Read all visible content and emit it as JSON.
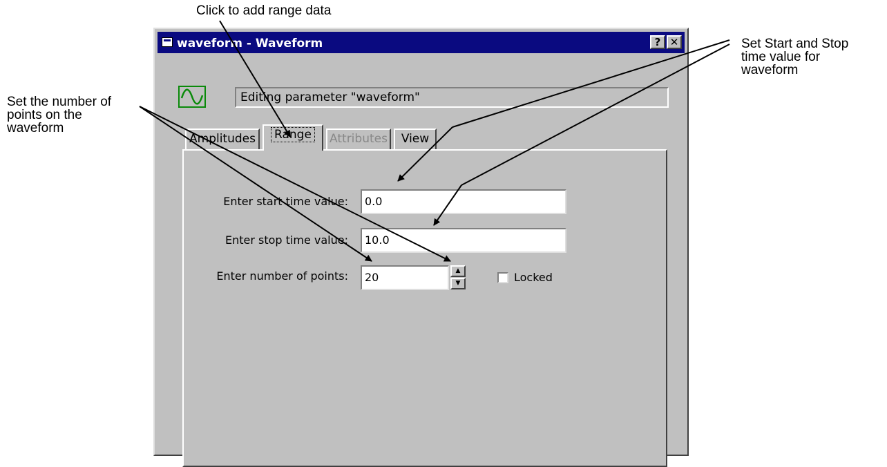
{
  "callouts": {
    "range": "Click to add range data",
    "start_stop": [
      "Set Start and Stop",
      "time value for",
      "waveform"
    ],
    "points": [
      "Set the number of",
      "points on the",
      "waveform"
    ]
  },
  "window": {
    "title": "waveform - Waveform",
    "help_label": "?",
    "close_label": "✕"
  },
  "editing_label": "Editing parameter \"waveform\"",
  "tabs": [
    {
      "label": "Amplitudes",
      "state": "normal"
    },
    {
      "label": "Range",
      "state": "active"
    },
    {
      "label": "Attributes",
      "state": "disabled"
    },
    {
      "label": "View",
      "state": "normal"
    }
  ],
  "form": {
    "start_label": "Enter start time value:",
    "start_value": "0.0",
    "stop_label": "Enter stop time value:",
    "stop_value": "10.0",
    "points_label": "Enter number of points:",
    "points_value": "20",
    "spin_up": "▲",
    "spin_down": "▼",
    "locked_label": "Locked",
    "locked_checked": false
  },
  "colors": {
    "titlebar": "#0a0a80",
    "window_face": "#c0c0c0",
    "wave_icon": "#0a8a0a"
  }
}
